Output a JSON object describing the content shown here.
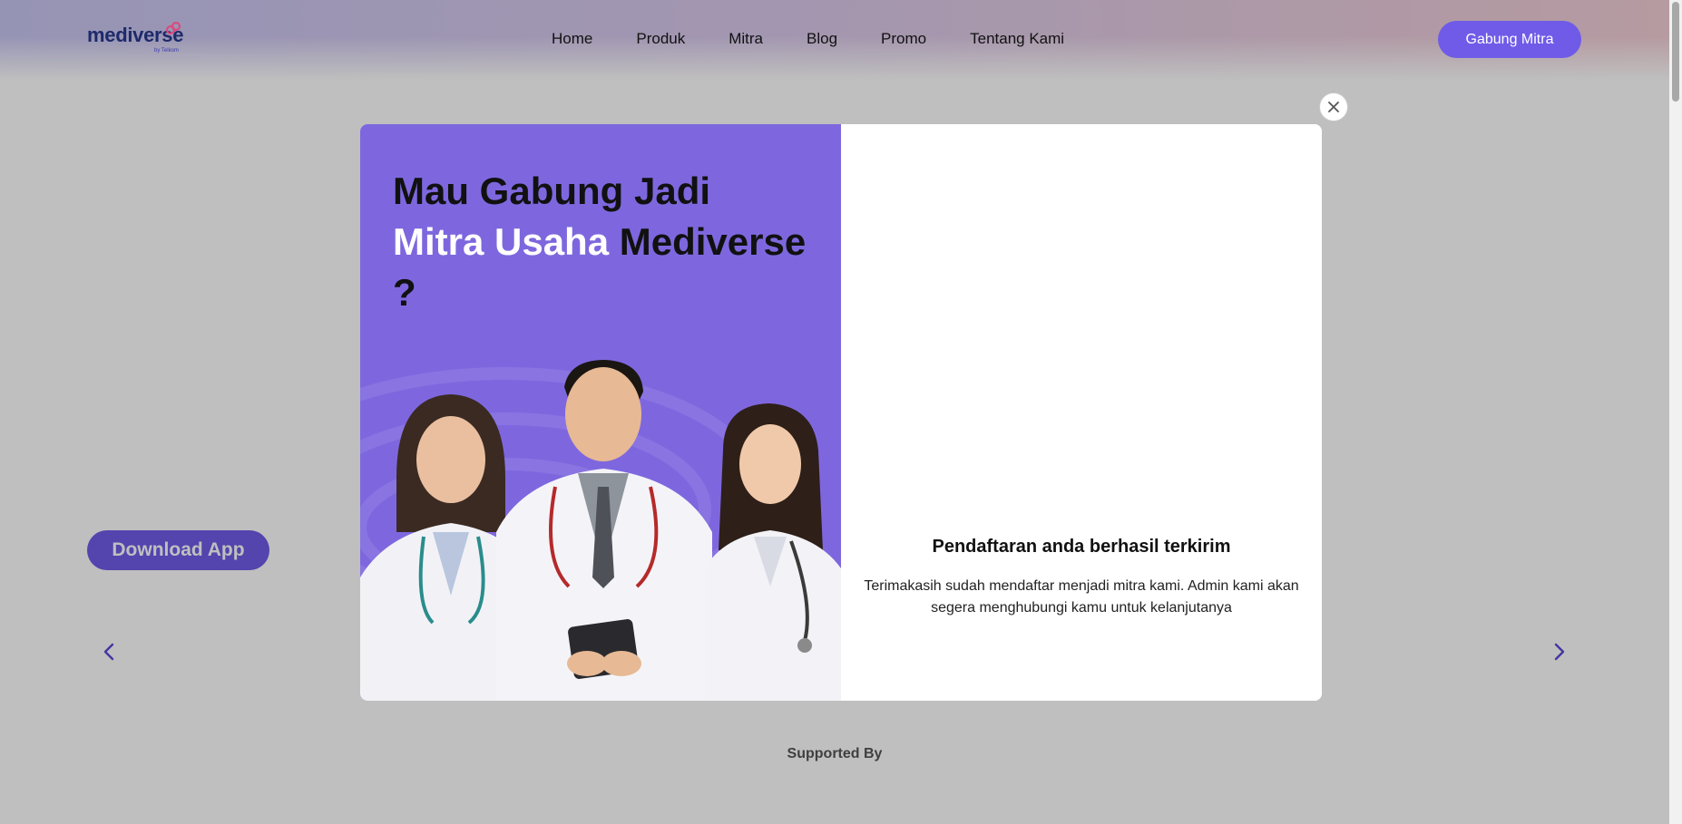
{
  "header": {
    "logo_text": "mediverse",
    "logo_sub": "by Telkom",
    "nav": [
      {
        "label": "Home"
      },
      {
        "label": "Produk"
      },
      {
        "label": "Mitra"
      },
      {
        "label": "Blog"
      },
      {
        "label": "Promo"
      },
      {
        "label": "Tentang Kami"
      }
    ],
    "cta_label": "Gabung Mitra"
  },
  "hero": {
    "download_label": "Download App",
    "prev_icon": "chevron-left-icon",
    "next_icon": "chevron-right-icon"
  },
  "supported_by": "Supported By",
  "modal": {
    "headline_line1": "Mau Gabung Jadi",
    "headline_white": "Mitra Usaha",
    "headline_line2_rest": " Mediverse",
    "headline_line3": "?",
    "success_title": "Pendaftaran anda berhasil terkirim",
    "success_text": "Terimakasih sudah mendaftar menjadi mitra kami. Admin kami akan segera menghubungi kamu untuk kelanjutanya",
    "close_icon": "close-icon"
  },
  "colors": {
    "brand_purple": "#6f5be8",
    "panel_purple": "#7e67de"
  }
}
